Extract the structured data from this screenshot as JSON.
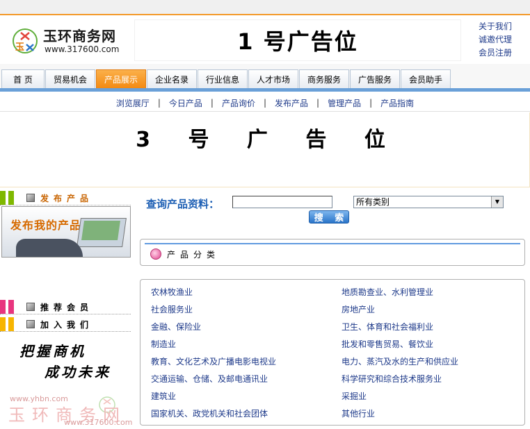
{
  "site": {
    "name": "玉环商务网",
    "url": "www.317600.com",
    "badge_text": "玉"
  },
  "ad1": "1 号广告位",
  "top_links": [
    "关于我们",
    "诚邀代理",
    "会员注册"
  ],
  "nav": {
    "tabs": [
      "首 页",
      "贸易机会",
      "产品展示",
      "企业名录",
      "行业信息",
      "人才市场",
      "商务服务",
      "广告服务",
      "会员助手"
    ],
    "active": "产品展示"
  },
  "subnav": [
    "浏览展厅",
    "今日产品",
    "产品询价",
    "发布产品",
    "管理产品",
    "产品指南"
  ],
  "ad3": "3 号 广 告 位",
  "left": {
    "publish_heading": "发布产品",
    "publish_banner": "发布我的产品",
    "recommend_heading": "推荐会员",
    "join_heading": "加入我们",
    "slogan_line1": "把握商机",
    "slogan_line2": "成功未来",
    "watermark_url1": "www.yhbn.com",
    "watermark_name": "玉环商务网",
    "watermark_url2": "www.317600.com"
  },
  "search": {
    "label": "查询产品资料：",
    "input_value": "",
    "category_selected": "所有类别",
    "button": "搜 索"
  },
  "categories_heading": "产品分类",
  "categories_left": [
    "农林牧渔业",
    "社会服务业",
    "金融、保险业",
    "制造业",
    "教育、文化艺术及广播电影电视业",
    "交通运输、仓储、及邮电通讯业",
    "建筑业",
    "国家机关、政党机关和社会团体"
  ],
  "categories_right": [
    "地质勘查业、水利管理业",
    "房地产业",
    "卫生、体育和社会福利业",
    "批发和零售贸易、餐饮业",
    "电力、蒸汽及水的生产和供应业",
    "科学研究和综合技术服务业",
    "采掘业",
    "其他行业"
  ],
  "colors": {
    "accent_orange": "#f38a12",
    "nav_blue": "#6aa0d8",
    "link_blue": "#1e3a8a",
    "search_label": "#1d5fb4"
  }
}
